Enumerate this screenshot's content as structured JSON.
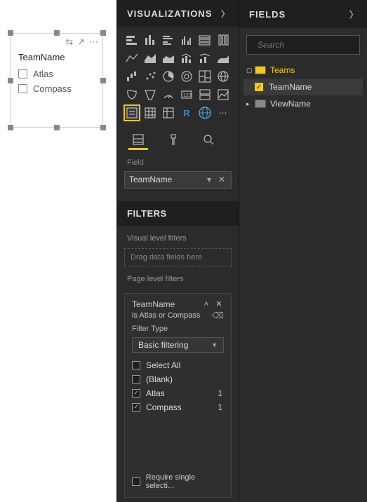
{
  "canvas": {
    "slicer": {
      "title": "TeamName",
      "items": [
        "Atlas",
        "Compass"
      ]
    }
  },
  "visualizations": {
    "header": "VISUALIZATIONS",
    "field_section_label": "Field",
    "field_well_value": "TeamName",
    "filters_header": "FILTERS",
    "visual_level_label": "Visual level filters",
    "dropzone_text": "Drag data fields here",
    "page_level_label": "Page level filters",
    "filter": {
      "title": "TeamName",
      "summary": "is Atlas or Compass",
      "type_label": "Filter Type",
      "type_value": "Basic filtering",
      "options": [
        {
          "label": "Select All",
          "checked": false,
          "count": ""
        },
        {
          "label": "(Blank)",
          "checked": false,
          "count": ""
        },
        {
          "label": "Atlas",
          "checked": true,
          "count": "1"
        },
        {
          "label": "Compass",
          "checked": true,
          "count": "1"
        }
      ],
      "require_single": "Require single selecti..."
    }
  },
  "fields": {
    "header": "FIELDS",
    "search_placeholder": "Search",
    "tree": {
      "table": "Teams",
      "columns": [
        {
          "name": "TeamName",
          "checked": true
        },
        {
          "name": "ViewName",
          "checked": false,
          "is_table_ref": true
        }
      ]
    }
  }
}
